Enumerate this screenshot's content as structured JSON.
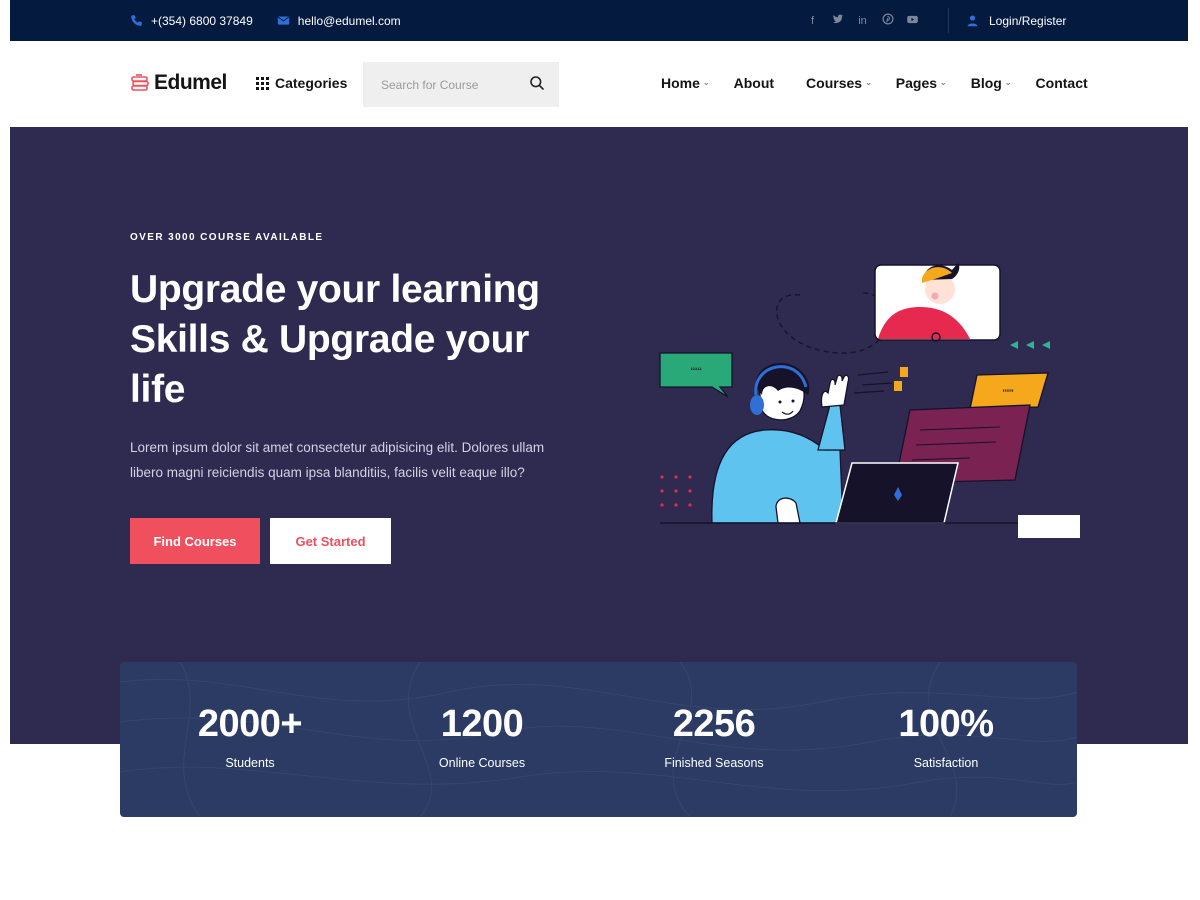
{
  "topbar": {
    "phone": "+(354) 6800 37849",
    "email": "hello@edumel.com",
    "social_icons": [
      "facebook-icon",
      "twitter-icon",
      "linkedin-icon",
      "pinterest-icon",
      "youtube-icon"
    ],
    "login_label": "Login/Register"
  },
  "header": {
    "logo_text": "Edumel",
    "categories_label": "Categories",
    "search_placeholder": "Search for Course",
    "nav": [
      {
        "label": "Home",
        "has_dropdown": true
      },
      {
        "label": "About",
        "has_dropdown": false
      },
      {
        "label": "Courses",
        "has_dropdown": true
      },
      {
        "label": "Pages",
        "has_dropdown": true
      },
      {
        "label": "Blog",
        "has_dropdown": true
      },
      {
        "label": "Contact",
        "has_dropdown": false
      }
    ]
  },
  "hero": {
    "eyebrow": "OVER 3000 COURSE AVAILABLE",
    "headline": "Upgrade your learning Skills & Upgrade your life",
    "description": "Lorem ipsum dolor sit amet consectetur adipisicing elit. Dolores ullam libero magni reiciendis quam ipsa blanditiis, facilis velit eaque illo?",
    "primary_button": "Find Courses",
    "secondary_button": "Get Started"
  },
  "stats": [
    {
      "value": "2000+",
      "label": "Students"
    },
    {
      "value": "1200",
      "label": "Online Courses"
    },
    {
      "value": "2256",
      "label": "Finished Seasons"
    },
    {
      "value": "100%",
      "label": "Satisfaction"
    }
  ],
  "colors": {
    "topbar_bg": "#041a3f",
    "hero_bg": "#2f2a4f",
    "accent": "#f0505d",
    "stats_bg": "#2b3b63",
    "icon_blue": "#2f6fd6"
  }
}
